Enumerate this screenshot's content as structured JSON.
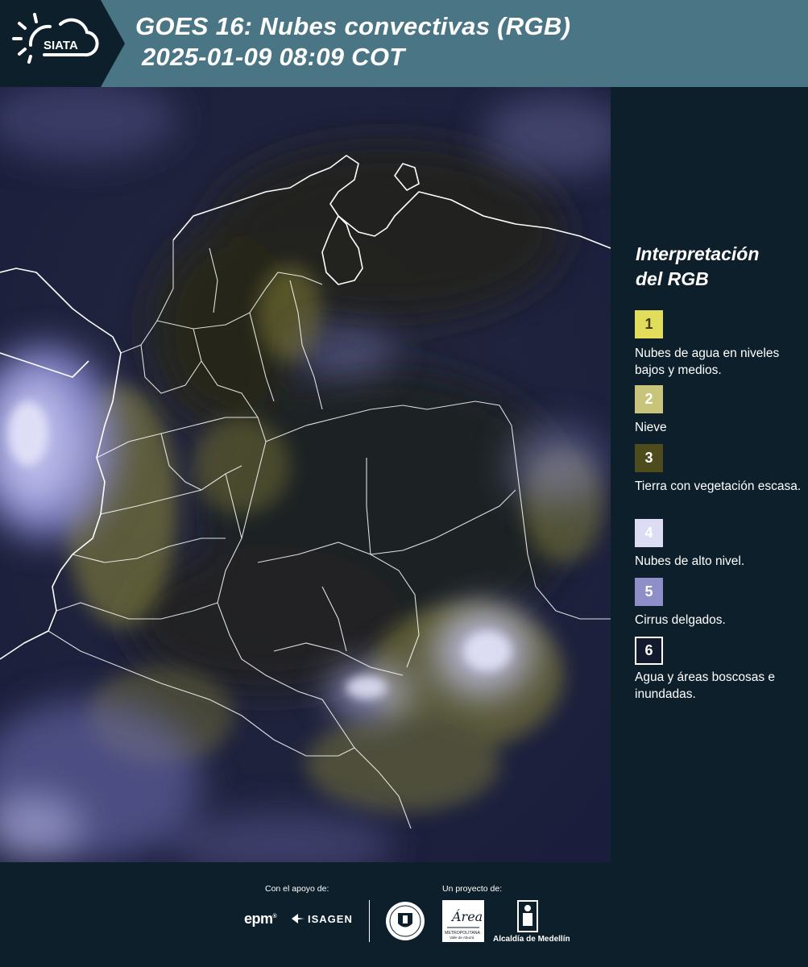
{
  "header": {
    "logo_text": "SIATA",
    "title_line1": "GOES 16: Nubes convectivas (RGB)",
    "title_line2": "2025-01-09 08:09 COT",
    "background_color": "#4a7585"
  },
  "legend": {
    "title_line1": "Interpretación",
    "title_line2": "del RGB",
    "items": [
      {
        "number": "1",
        "label": "Nubes de agua en niveles bajos y medios.",
        "color": "#e1dc5a",
        "text_color": "#3d3a10"
      },
      {
        "number": "2",
        "label": "Nieve",
        "color": "#c8c57a",
        "text_color": "#ffffff"
      },
      {
        "number": "3",
        "label": "Tierra con vegetación escasa.",
        "color": "#4e4c1c",
        "text_color": "#ffffff"
      },
      {
        "number": "4",
        "label": "Nubes de alto nivel.",
        "color": "#dcdcf5",
        "text_color": "#ffffff"
      },
      {
        "number": "5",
        "label": "Cirrus delgados.",
        "color": "#8e8ec8",
        "text_color": "#ffffff"
      },
      {
        "number": "6",
        "label": "Agua y áreas boscosas e inundadas.",
        "color": "#141a2e",
        "text_color": "#ffffff"
      }
    ]
  },
  "footer": {
    "support_label": "Con el apoyo de:",
    "project_label": "Un proyecto de:",
    "epm_text": "epm",
    "isagen_text": "ISAGEN",
    "metro_text": "METROPOLITANA",
    "metro_sub": "Valle de Aburrá",
    "metro_script": "Área",
    "alcaldia_text": "Alcaldía de Medellín"
  },
  "icons": {
    "logo": "sun-cloud-icon",
    "seal": "medellin-seal-icon",
    "metro": "area-metropolitana-icon",
    "alcaldia": "alcaldia-building-icon"
  }
}
